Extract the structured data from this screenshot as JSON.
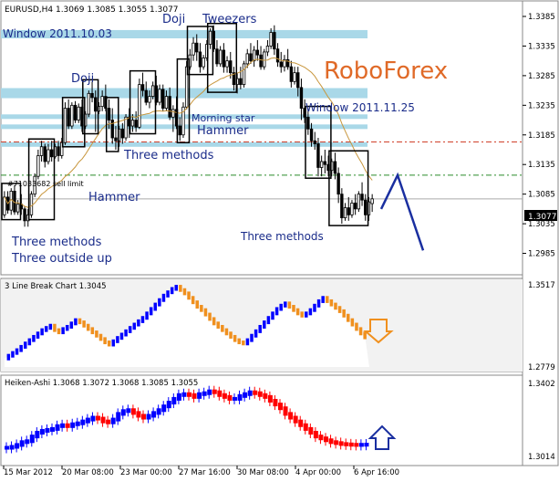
{
  "chart_data": [
    {
      "type": "candlestick",
      "panel_title": "EURUSD,H4  1.3069  1.3085  1.3055  1.3077",
      "brand": "RoboForex",
      "ylim": [
        1.2955,
        1.3385
      ],
      "yticks": [
        "1.3385",
        "1.3335",
        "1.3285",
        "1.3235",
        "1.3185",
        "1.3135",
        "1.3085",
        "1.3035",
        "1.2985"
      ],
      "price_label": "1.3077",
      "price_value": 1.3077,
      "levels": {
        "sell_limit": {
          "label": "#71033682 sell limit",
          "value": 1.3117
        },
        "resistance": 1.3173,
        "current": 1.3077
      },
      "windows": [
        {
          "label": "Window 2011.10.03",
          "from": 1.3348,
          "to": 1.3362
        },
        {
          "label": "Window 2011.11.25",
          "from": 1.3247,
          "to": 1.3264
        }
      ],
      "annotations": [
        "Doji",
        "Tweezers",
        "Doji",
        "Morning star",
        "Hammer",
        "Hammer",
        "Three methods",
        "Three methods",
        "Three methods",
        "Three outside up"
      ],
      "candles": [
        [
          1.305,
          1.309,
          1.308,
          1.3045
        ],
        [
          1.308,
          1.309,
          1.3058,
          1.3052
        ],
        [
          1.3058,
          1.3095,
          1.309,
          1.305
        ],
        [
          1.309,
          1.31,
          1.3055,
          1.305
        ],
        [
          1.3055,
          1.3075,
          1.3068,
          1.305
        ],
        [
          1.3068,
          1.3085,
          1.306,
          1.305
        ],
        [
          1.306,
          1.3065,
          1.304,
          1.303
        ],
        [
          1.304,
          1.306,
          1.305,
          1.303
        ],
        [
          1.305,
          1.309,
          1.3085,
          1.3045
        ],
        [
          1.3085,
          1.312,
          1.3115,
          1.308
        ],
        [
          1.3115,
          1.316,
          1.315,
          1.311
        ],
        [
          1.315,
          1.3175,
          1.3165,
          1.314
        ],
        [
          1.3165,
          1.317,
          1.314,
          1.313
        ],
        [
          1.314,
          1.317,
          1.316,
          1.3135
        ],
        [
          1.316,
          1.3175,
          1.3148,
          1.314
        ],
        [
          1.3148,
          1.317,
          1.3165,
          1.3145
        ],
        [
          1.3165,
          1.3175,
          1.315,
          1.314
        ],
        [
          1.315,
          1.318,
          1.3172,
          1.3145
        ],
        [
          1.3172,
          1.324,
          1.323,
          1.3168
        ],
        [
          1.323,
          1.3245,
          1.32,
          1.3195
        ],
        [
          1.32,
          1.324,
          1.3235,
          1.3195
        ],
        [
          1.3235,
          1.3242,
          1.321,
          1.3205
        ],
        [
          1.321,
          1.3238,
          1.3232,
          1.3205
        ],
        [
          1.3232,
          1.3245,
          1.32,
          1.319
        ],
        [
          1.32,
          1.3225,
          1.322,
          1.3195
        ],
        [
          1.322,
          1.326,
          1.3255,
          1.3215
        ],
        [
          1.3255,
          1.3275,
          1.3248,
          1.324
        ],
        [
          1.3248,
          1.326,
          1.3225,
          1.319
        ],
        [
          1.3225,
          1.324,
          1.3233,
          1.322
        ],
        [
          1.3233,
          1.326,
          1.325,
          1.3225
        ],
        [
          1.325,
          1.327,
          1.323,
          1.3225
        ],
        [
          1.323,
          1.3245,
          1.321,
          1.3195
        ],
        [
          1.321,
          1.323,
          1.318,
          1.317
        ],
        [
          1.318,
          1.32,
          1.3175,
          1.316
        ],
        [
          1.3175,
          1.32,
          1.3195,
          1.3165
        ],
        [
          1.3195,
          1.3205,
          1.318,
          1.317
        ],
        [
          1.318,
          1.322,
          1.3215,
          1.3175
        ],
        [
          1.3215,
          1.323,
          1.32,
          1.318
        ],
        [
          1.32,
          1.322,
          1.321,
          1.319
        ],
        [
          1.321,
          1.3225,
          1.3198,
          1.319
        ],
        [
          1.3198,
          1.328,
          1.327,
          1.3195
        ],
        [
          1.327,
          1.329,
          1.326,
          1.325
        ],
        [
          1.326,
          1.3275,
          1.324,
          1.3235
        ],
        [
          1.324,
          1.326,
          1.325,
          1.323
        ],
        [
          1.325,
          1.3275,
          1.3268,
          1.3245
        ],
        [
          1.3268,
          1.3285,
          1.324,
          1.3235
        ],
        [
          1.324,
          1.327,
          1.3262,
          1.3235
        ],
        [
          1.3262,
          1.327,
          1.323,
          1.3225
        ],
        [
          1.323,
          1.326,
          1.325,
          1.3225
        ],
        [
          1.325,
          1.3265,
          1.3215,
          1.321
        ],
        [
          1.3215,
          1.3235,
          1.3228,
          1.319
        ],
        [
          1.3228,
          1.325,
          1.32,
          1.3195
        ],
        [
          1.32,
          1.3215,
          1.3185,
          1.3175
        ],
        [
          1.3185,
          1.324,
          1.3232,
          1.318
        ],
        [
          1.3232,
          1.331,
          1.33,
          1.3228
        ],
        [
          1.33,
          1.333,
          1.332,
          1.3295
        ],
        [
          1.332,
          1.335,
          1.334,
          1.331
        ],
        [
          1.334,
          1.3355,
          1.3325,
          1.331
        ],
        [
          1.3325,
          1.334,
          1.33,
          1.329
        ],
        [
          1.33,
          1.332,
          1.3315,
          1.3295
        ],
        [
          1.3315,
          1.3345,
          1.3338,
          1.331
        ],
        [
          1.3338,
          1.3365,
          1.336,
          1.333
        ],
        [
          1.336,
          1.337,
          1.333,
          1.3325
        ],
        [
          1.333,
          1.3345,
          1.3305,
          1.33
        ],
        [
          1.3305,
          1.3335,
          1.3328,
          1.33
        ],
        [
          1.3328,
          1.334,
          1.33,
          1.329
        ],
        [
          1.33,
          1.3318,
          1.331,
          1.329
        ],
        [
          1.331,
          1.3325,
          1.329,
          1.328
        ],
        [
          1.329,
          1.33,
          1.327,
          1.326
        ],
        [
          1.327,
          1.329,
          1.328,
          1.3255
        ],
        [
          1.328,
          1.33,
          1.327,
          1.3262
        ],
        [
          1.327,
          1.331,
          1.3305,
          1.3265
        ],
        [
          1.3305,
          1.333,
          1.3322,
          1.3298
        ],
        [
          1.3322,
          1.334,
          1.331,
          1.3305
        ],
        [
          1.331,
          1.3335,
          1.3328,
          1.33
        ],
        [
          1.3328,
          1.3345,
          1.332,
          1.331
        ],
        [
          1.332,
          1.3335,
          1.33,
          1.3295
        ],
        [
          1.33,
          1.333,
          1.3325,
          1.3295
        ],
        [
          1.3325,
          1.3345,
          1.3335,
          1.3318
        ],
        [
          1.3335,
          1.3365,
          1.3358,
          1.333
        ],
        [
          1.3358,
          1.337,
          1.333,
          1.332
        ],
        [
          1.333,
          1.334,
          1.3308,
          1.33
        ],
        [
          1.3308,
          1.3325,
          1.33,
          1.329
        ],
        [
          1.33,
          1.332,
          1.3312,
          1.3292
        ],
        [
          1.3312,
          1.333,
          1.33,
          1.3295
        ],
        [
          1.33,
          1.331,
          1.3275,
          1.3265
        ],
        [
          1.3275,
          1.33,
          1.329,
          1.327
        ],
        [
          1.329,
          1.33,
          1.3265,
          1.325
        ],
        [
          1.3265,
          1.328,
          1.323,
          1.321
        ],
        [
          1.323,
          1.3245,
          1.3215,
          1.3205
        ],
        [
          1.3215,
          1.323,
          1.3195,
          1.3185
        ],
        [
          1.3195,
          1.3205,
          1.3175,
          1.3165
        ],
        [
          1.3175,
          1.319,
          1.317,
          1.316
        ],
        [
          1.317,
          1.318,
          1.313,
          1.3115
        ],
        [
          1.313,
          1.315,
          1.314,
          1.3115
        ],
        [
          1.314,
          1.316,
          1.3135,
          1.312
        ],
        [
          1.3135,
          1.315,
          1.3125,
          1.3115
        ],
        [
          1.3125,
          1.3145,
          1.314,
          1.3115
        ],
        [
          1.314,
          1.3155,
          1.312,
          1.311
        ],
        [
          1.312,
          1.313,
          1.3085,
          1.307
        ],
        [
          1.3085,
          1.3095,
          1.3045,
          1.3035
        ],
        [
          1.3045,
          1.307,
          1.3062,
          1.304
        ],
        [
          1.3062,
          1.308,
          1.305,
          1.304
        ],
        [
          1.305,
          1.3075,
          1.307,
          1.3045
        ],
        [
          1.307,
          1.3085,
          1.306,
          1.305
        ],
        [
          1.306,
          1.309,
          1.3085,
          1.3055
        ],
        [
          1.3085,
          1.3105,
          1.3075,
          1.3065
        ],
        [
          1.3075,
          1.3085,
          1.305,
          1.304
        ],
        [
          1.305,
          1.308,
          1.3072,
          1.304
        ],
        [
          1.3069,
          1.3085,
          1.3077,
          1.3055
        ]
      ],
      "forecast_path": [
        1.306,
        1.3117,
        1.299
      ]
    },
    {
      "type": "line",
      "panel_title": "3 Line Break Chart  1.3045",
      "ylim": [
        1.2779,
        1.3517
      ],
      "yticks": [
        "1.3517",
        "1.2779"
      ],
      "arrow": "down",
      "series": [
        {
          "values": [
            1.2855,
            1.288,
            1.2905,
            1.293,
            1.296,
            1.299,
            1.302,
            1.305,
            1.308,
            1.311,
            1.313,
            1.315,
            1.311,
            1.309,
            1.312,
            1.314,
            1.317,
            1.32,
            1.318,
            1.315,
            1.312,
            1.309,
            1.306,
            1.303,
            1.3,
            1.298,
            1.301,
            1.304,
            1.307,
            1.31,
            1.313,
            1.316,
            1.319,
            1.322,
            1.326,
            1.33,
            1.334,
            1.338,
            1.342,
            1.345,
            1.348,
            1.35,
            1.347,
            1.344,
            1.34,
            1.336,
            1.332,
            1.329,
            1.325,
            1.321,
            1.317,
            1.314,
            1.311,
            1.308,
            1.305,
            1.302,
            1.3,
            1.299,
            1.302,
            1.306,
            1.31,
            1.314,
            1.318,
            1.322,
            1.326,
            1.33,
            1.333,
            1.335,
            1.332,
            1.329,
            1.326,
            1.324,
            1.326,
            1.329,
            1.333,
            1.337,
            1.34,
            1.337,
            1.334,
            1.331,
            1.328,
            1.324,
            1.32,
            1.316,
            1.312,
            1.308,
            1.3045
          ]
        }
      ]
    },
    {
      "type": "line",
      "panel_title": "Heiken-Ashi  1.3068  1.3072  1.3068  1.3085  1.3055",
      "ylim": [
        1.3014,
        1.3402
      ],
      "yticks": [
        "1.3402",
        "1.3014"
      ],
      "arrow": "up",
      "categories": [
        "15 Mar 2012",
        "20 Mar 08:00",
        "23 Mar 00:00",
        "27 Mar 16:00",
        "30 Mar 08:00",
        "4 Apr 00:00",
        "6 Apr 16:00"
      ],
      "series": [
        {
          "values": [
            1.306,
            1.3065,
            1.3075,
            1.309,
            1.3095,
            1.312,
            1.314,
            1.315,
            1.3155,
            1.316,
            1.3175,
            1.318,
            1.3175,
            1.3185,
            1.319,
            1.32,
            1.321,
            1.322,
            1.3215,
            1.32,
            1.3195,
            1.321,
            1.324,
            1.3255,
            1.326,
            1.3245,
            1.323,
            1.322,
            1.323,
            1.3245,
            1.326,
            1.328,
            1.33,
            1.332,
            1.334,
            1.3345,
            1.334,
            1.333,
            1.3345,
            1.335,
            1.336,
            1.3355,
            1.334,
            1.333,
            1.332,
            1.332,
            1.3335,
            1.3345,
            1.3355,
            1.335,
            1.334,
            1.333,
            1.331,
            1.329,
            1.327,
            1.324,
            1.322,
            1.32,
            1.318,
            1.316,
            1.314,
            1.312,
            1.311,
            1.31,
            1.309,
            1.3085,
            1.308,
            1.3078,
            1.3076,
            1.3075,
            1.3076,
            1.3077
          ]
        }
      ]
    }
  ],
  "colors": {
    "bull": "#0000ff",
    "bear": "#ff0000",
    "orange": "#f0901e",
    "window": "#a9d8e8",
    "ma": "#c8963c",
    "forecast": "#1a2fa0",
    "brand": "#e06a28",
    "axis_bg": "#ffffff"
  }
}
